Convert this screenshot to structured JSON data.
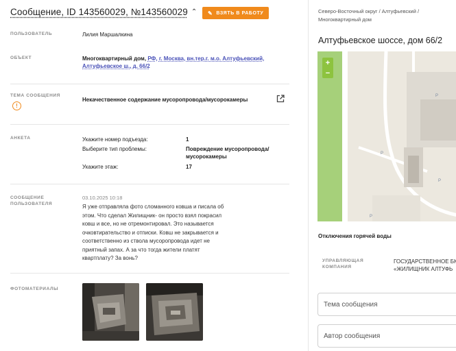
{
  "header": {
    "title": "Сообщение, ID 143560029, №143560029",
    "take_button": "ВЗЯТЬ В РАБОТУ"
  },
  "details": {
    "user_label": "ПОЛЬЗОВАТЕЛЬ",
    "user_value": "Лилия Маршалкина",
    "object_label": "ОБЪЕКТ",
    "object_type": "Многоквартирный дом,",
    "object_link_1": "РФ, г. Москва, вн.тер.г. м.о. Алтуфьевский,",
    "object_link_2": "Алтуфьевское ш., д. 66/2",
    "topic_label": "ТЕМА СООБЩЕНИЯ",
    "topic_value": "Некачественное содержание мусоропровода/мусорокамеры",
    "survey_label": "АНКЕТА",
    "survey": [
      {
        "question": "Укажите номер подъезда:",
        "answer": "1"
      },
      {
        "question": "Выберите тип проблемы:",
        "answer_1": "Повреждение мусоропровода/",
        "answer_2": "мусорокамеры"
      },
      {
        "question": "Укажите этаж:",
        "answer": "17"
      }
    ],
    "message_label_1": "СООБЩЕНИЕ",
    "message_label_2": "ПОЛЬЗОВАТЕЛЯ",
    "message_date": "03.10.2025 10:18",
    "message_lines": [
      "Я уже отправляла фото сломанного ковша и писала об",
      "этом. Что сделал Жилищник- он просто взял покрасил",
      "ковш и все, но не отремонтировал. Это называется",
      "очковтирательство и отписки. Ковш не закрывается и",
      "соответственно из ствола мусоропровода идет не",
      "приятный запах. А за что тогда жители платят",
      "квартплату? За вонь?"
    ],
    "photos_label": "ФОТОМАТЕРИАЛЫ"
  },
  "right": {
    "breadcrumb_1": "Северо-Восточный округ / Алтуфьевский /",
    "breadcrumb_2": "Многоквартирный дом",
    "address": "Алтуфьевское шоссе, дом 66/2",
    "zoom_in": "+",
    "zoom_out": "−",
    "hot_water": "Отключения горячей воды",
    "mc_label_1": "УПРАВЛЯЮЩАЯ",
    "mc_label_2": "КОМПАНИЯ",
    "mc_value_1": "ГОСУДАРСТВЕННОЕ БЮ",
    "mc_value_2": "«ЖИЛИЩНИК АЛТУФЬ",
    "topic_field_placeholder": "Тема сообщения",
    "author_field_placeholder": "Автор сообщения"
  },
  "colors": {
    "accent": "#f08a1c",
    "link": "#4a52b8",
    "map_zoom": "#8dc33f"
  }
}
